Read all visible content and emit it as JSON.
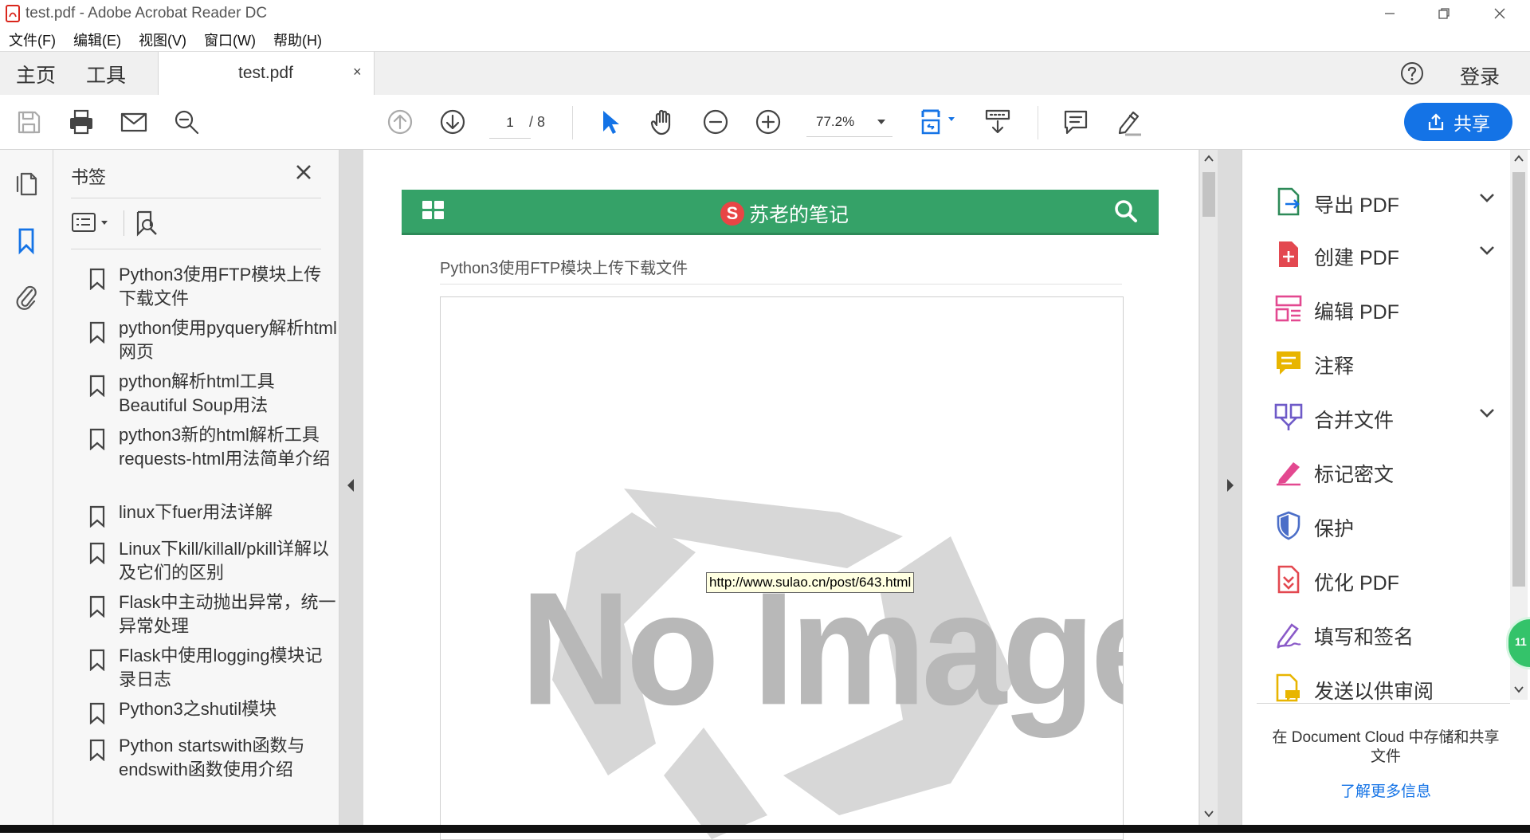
{
  "window": {
    "title": "test.pdf - Adobe Acrobat Reader DC"
  },
  "menu": [
    "文件(F)",
    "编辑(E)",
    "视图(V)",
    "窗口(W)",
    "帮助(H)"
  ],
  "tabs": {
    "home": "主页",
    "tools": "工具",
    "document": "test.pdf",
    "close": "×",
    "login": "登录"
  },
  "toolbar": {
    "page_current": "1",
    "page_total": "/ 8",
    "zoom": "77.2%",
    "share": "共享"
  },
  "bookmarks": {
    "title": "书签",
    "items": [
      "Python3使用FTP模块上传下载文件",
      "python使用pyquery解析html网页",
      "python解析html工具Beautiful Soup用法",
      "python3新的html解析工具requests-html用法简单介绍",
      "linux下fuer用法详解",
      "Linux下kill/killall/pkill详解以及它们的区别",
      "Flask中主动抛出异常，统一异常处理",
      "Flask中使用logging模块记录日志",
      "Python3之shutil模块",
      "Python startswith函数与endswith函数使用介绍"
    ]
  },
  "document": {
    "site_logo": "S",
    "site_name": "苏老的笔记",
    "article_title": "Python3使用FTP模块上传下载文件",
    "placeholder_image_text": "No Image",
    "link_tooltip": "http://www.sulao.cn/post/643.html"
  },
  "right_panel": {
    "tools": [
      {
        "label": "导出 PDF",
        "icon": "export-pdf-icon",
        "color": "#2d8a58",
        "expandable": true
      },
      {
        "label": "创建 PDF",
        "icon": "create-pdf-icon",
        "color": "#e34850",
        "expandable": true
      },
      {
        "label": "编辑 PDF",
        "icon": "edit-pdf-icon",
        "color": "#e34890",
        "expandable": false
      },
      {
        "label": "注释",
        "icon": "comment-icon",
        "color": "#e8b500",
        "expandable": false
      },
      {
        "label": "合并文件",
        "icon": "combine-files-icon",
        "color": "#6e5ac8",
        "expandable": true
      },
      {
        "label": "标记密文",
        "icon": "redact-icon",
        "color": "#e34890",
        "expandable": false
      },
      {
        "label": "保护",
        "icon": "protect-icon",
        "color": "#4b6ec8",
        "expandable": false
      },
      {
        "label": "优化 PDF",
        "icon": "optimize-pdf-icon",
        "color": "#e34850",
        "expandable": false
      },
      {
        "label": "填写和签名",
        "icon": "fill-sign-icon",
        "color": "#8a5ac8",
        "expandable": false
      },
      {
        "label": "发送以供审阅",
        "icon": "send-review-icon",
        "color": "#e8b500",
        "expandable": false
      }
    ],
    "cloud_text": "在 Document Cloud 中存储和共享文件",
    "learn_more": "了解更多信息"
  },
  "badge": "11"
}
